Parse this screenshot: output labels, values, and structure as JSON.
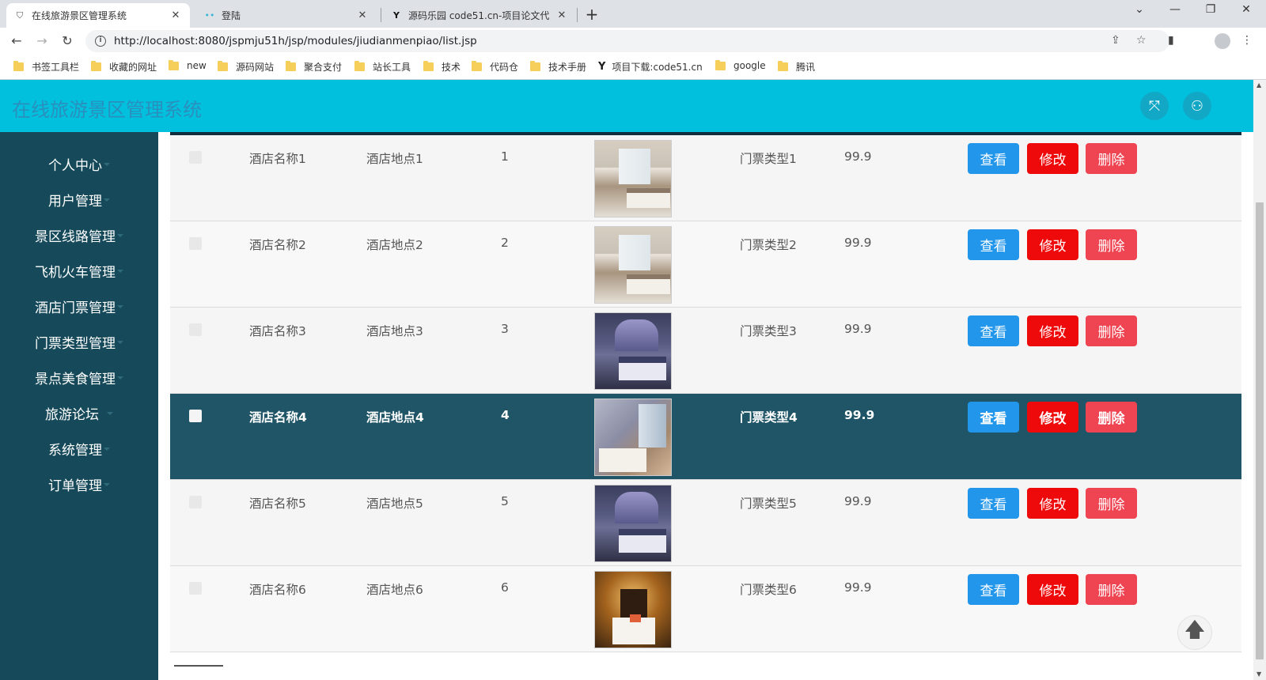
{
  "browser": {
    "tabs": [
      {
        "title": "在线旅游景区管理系统",
        "active": true
      },
      {
        "title": "登陆",
        "active": false
      },
      {
        "title": "源码乐园 code51.cn-项目论文代",
        "active": false
      }
    ],
    "url": "http://localhost:8080/jspmju51h/jsp/modules/jiudianmenpiao/list.jsp",
    "bookmarks": [
      "书签工具栏",
      "收藏的网址",
      "new",
      "源码网站",
      "聚合支付",
      "站长工具",
      "技术",
      "代码仓",
      "技术手册",
      "项目下载:code51.cn",
      "google",
      "腾讯"
    ]
  },
  "app": {
    "title": "在线旅游景区管理系统"
  },
  "sidebar": {
    "items": [
      {
        "label": "个人中心"
      },
      {
        "label": "用户管理"
      },
      {
        "label": "景区线路管理"
      },
      {
        "label": "飞机火车管理"
      },
      {
        "label": "酒店门票管理"
      },
      {
        "label": "门票类型管理"
      },
      {
        "label": "景点美食管理"
      },
      {
        "label": "旅游论坛"
      },
      {
        "label": "系统管理"
      },
      {
        "label": "订单管理"
      }
    ]
  },
  "table": {
    "rows": [
      {
        "name": "酒店名称1",
        "place": "酒店地点1",
        "num": "1",
        "type": "门票类型1",
        "price": "99.9"
      },
      {
        "name": "酒店名称2",
        "place": "酒店地点2",
        "num": "2",
        "type": "门票类型2",
        "price": "99.9"
      },
      {
        "name": "酒店名称3",
        "place": "酒店地点3",
        "num": "3",
        "type": "门票类型3",
        "price": "99.9"
      },
      {
        "name": "酒店名称4",
        "place": "酒店地点4",
        "num": "4",
        "type": "门票类型4",
        "price": "99.9"
      },
      {
        "name": "酒店名称5",
        "place": "酒店地点5",
        "num": "5",
        "type": "门票类型5",
        "price": "99.9"
      },
      {
        "name": "酒店名称6",
        "place": "酒店地点6",
        "num": "6",
        "type": "门票类型6",
        "price": "99.9"
      }
    ]
  },
  "actions": {
    "view": "查看",
    "edit": "修改",
    "delete": "删除"
  },
  "colors": {
    "header": "#00c0de",
    "sidebar": "#164a5b",
    "highlight_row": "#1f5567",
    "view_button": "#2196ea",
    "edit_button": "#ee0a0a",
    "delete_button": "#ef4452"
  }
}
